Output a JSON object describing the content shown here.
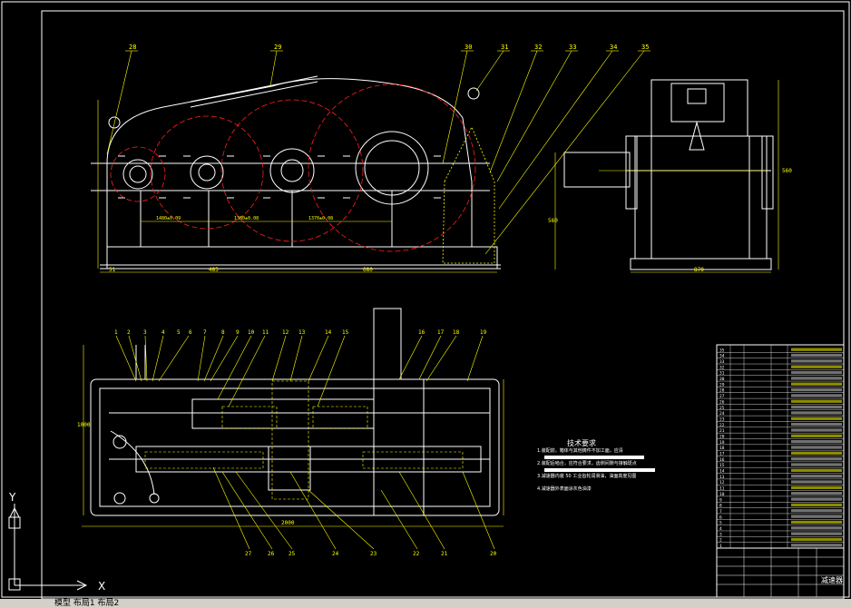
{
  "drawing": {
    "colors": {
      "background": "#000000",
      "outline": "#ffffff",
      "dimension": "#ffff00",
      "gear": "#ff2020",
      "section": "#00ffff"
    },
    "front_view": {
      "callouts": [
        "28",
        "29",
        "30",
        "31",
        "32",
        "33",
        "34",
        "35"
      ],
      "dims_bottom": [
        "51",
        "485",
        "680"
      ],
      "center_dims": [
        "1480±0.09",
        "1380±0.08",
        "1370±0.08"
      ]
    },
    "side_view": {
      "dims_bottom": [
        "870"
      ],
      "dim_right": "560",
      "dim_left": "560"
    },
    "plan_view": {
      "callouts_top": [
        "1",
        "2",
        "3",
        "4",
        "5",
        "6",
        "7",
        "8",
        "9",
        "10",
        "11",
        "12",
        "13",
        "14",
        "15",
        "16",
        "17",
        "18",
        "19"
      ],
      "callouts_bottom": [
        "20",
        "21",
        "22",
        "23",
        "24",
        "25",
        "26",
        "27"
      ],
      "dim_bottom": "2000",
      "dim_left": "1000"
    },
    "tech_requirements": {
      "title": "技术要求",
      "items": [
        "1.装配前，箱体与其他铸件不加工面，应清",
        "2.装配后啮合，应符合要求，齿侧间隙与接触斑点",
        "3.减速器内装 50 工业齿轮润滑油，油面高度见图",
        "4.减速器外表面涂灰色油漆"
      ]
    },
    "parts_table": {
      "rows": [
        "35",
        "34",
        "33",
        "32",
        "31",
        "30",
        "29",
        "28",
        "27",
        "26",
        "25",
        "24",
        "23",
        "22",
        "21",
        "20",
        "19",
        "18",
        "17",
        "16",
        "15",
        "14",
        "13",
        "12",
        "11",
        "10",
        "9",
        "8",
        "7",
        "6",
        "5",
        "4",
        "3",
        "2",
        "1"
      ],
      "title": "减速器"
    },
    "ucs": {
      "x_label": "X",
      "y_label": "Y"
    }
  },
  "statusbar": {
    "text": "模型  布局1  布局2"
  }
}
